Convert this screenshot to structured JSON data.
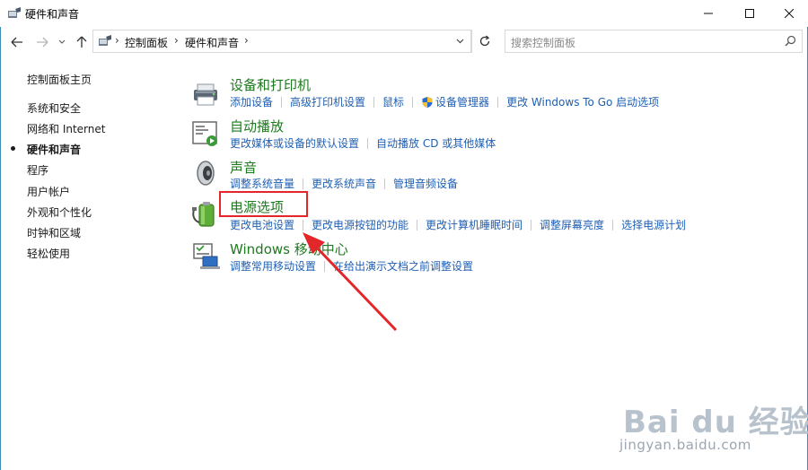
{
  "window": {
    "title": "硬件和声音"
  },
  "address": {
    "crumbs": [
      "控制面板",
      "硬件和声音"
    ]
  },
  "search": {
    "placeholder": "搜索控制面板"
  },
  "sidebar": {
    "items": [
      {
        "label": "控制面板主页"
      },
      {
        "label": "系统和安全"
      },
      {
        "label": "网络和 Internet"
      },
      {
        "label": "硬件和声音",
        "active": true
      },
      {
        "label": "程序"
      },
      {
        "label": "用户帐户"
      },
      {
        "label": "外观和个性化"
      },
      {
        "label": "时钟和区域"
      },
      {
        "label": "轻松使用"
      }
    ]
  },
  "categories": [
    {
      "title": "设备和打印机",
      "icon": "printer-icon",
      "links": [
        "添加设备",
        "高级打印机设置",
        "鼠标",
        "设备管理器",
        "更改 Windows To Go 启动选项"
      ]
    },
    {
      "title": "自动播放",
      "icon": "autoplay-icon",
      "links": [
        "更改媒体或设备的默认设置",
        "自动播放 CD 或其他媒体"
      ]
    },
    {
      "title": "声音",
      "icon": "speaker-icon",
      "links": [
        "调整系统音量",
        "更改系统声音",
        "管理音频设备"
      ]
    },
    {
      "title": "电源选项",
      "icon": "battery-icon",
      "links": [
        "更改电池设置",
        "更改电源按钮的功能",
        "更改计算机睡眠时间",
        "调整屏幕亮度",
        "选择电源计划"
      ]
    },
    {
      "title": "Windows 移动中心",
      "icon": "mobility-center-icon",
      "links": [
        "调整常用移动设置",
        "在给出演示文档之前调整设置"
      ]
    }
  ],
  "watermark": {
    "brand": "Bai du 经验",
    "url": "jingyan.baidu.com"
  },
  "colors": {
    "category_title": "#1e7a1e",
    "link": "#1f5fb3",
    "highlight": "#e3262a",
    "arrow": "#e3262a"
  }
}
